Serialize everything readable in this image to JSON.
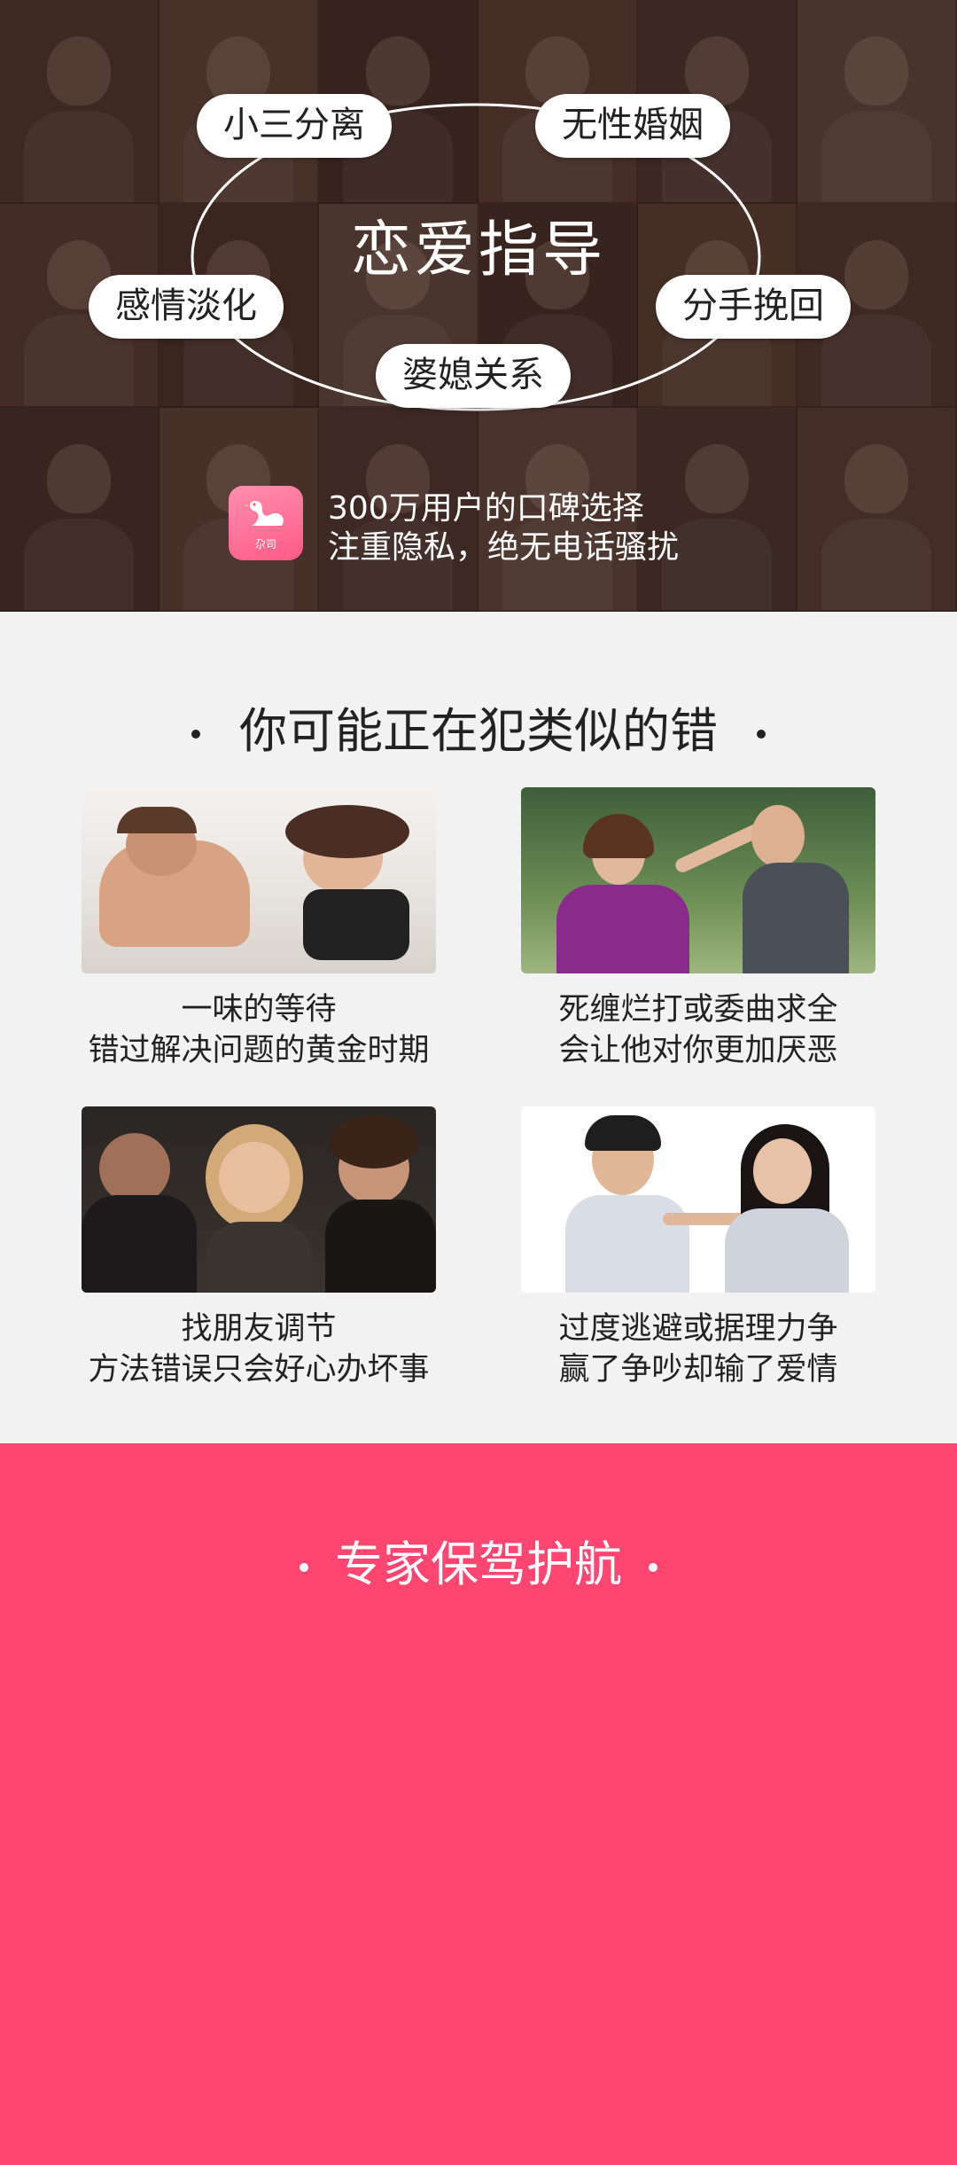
{
  "hero": {
    "title": "恋爱指导",
    "tags": {
      "top_left": "小三分离",
      "top_right": "无性婚姻",
      "mid_left": "感情淡化",
      "mid_right": "分手挽回",
      "bottom": "婆媳关系"
    },
    "badge_text": "尕司",
    "line1": "300万用户的口碑选择",
    "line2": "注重隐私，绝无电话骚扰"
  },
  "mistakes": {
    "title": "你可能正在犯类似的错",
    "cards": [
      {
        "line1": "一味的等待",
        "line2": "错过解决问题的黄金时期"
      },
      {
        "line1": "死缠烂打或委曲求全",
        "line2": "会让他对你更加厌恶"
      },
      {
        "line1": "找朋友调节",
        "line2": "方法错误只会好心办坏事"
      },
      {
        "line1": "过度逃避或据理力争",
        "line2": "赢了争吵却输了爱情"
      }
    ]
  },
  "expert": {
    "title": "专家保驾护航"
  },
  "colors": {
    "accent": "#ff4670",
    "page_bg": "#f2f2f2",
    "hero_overlay": "#2a1a14"
  }
}
